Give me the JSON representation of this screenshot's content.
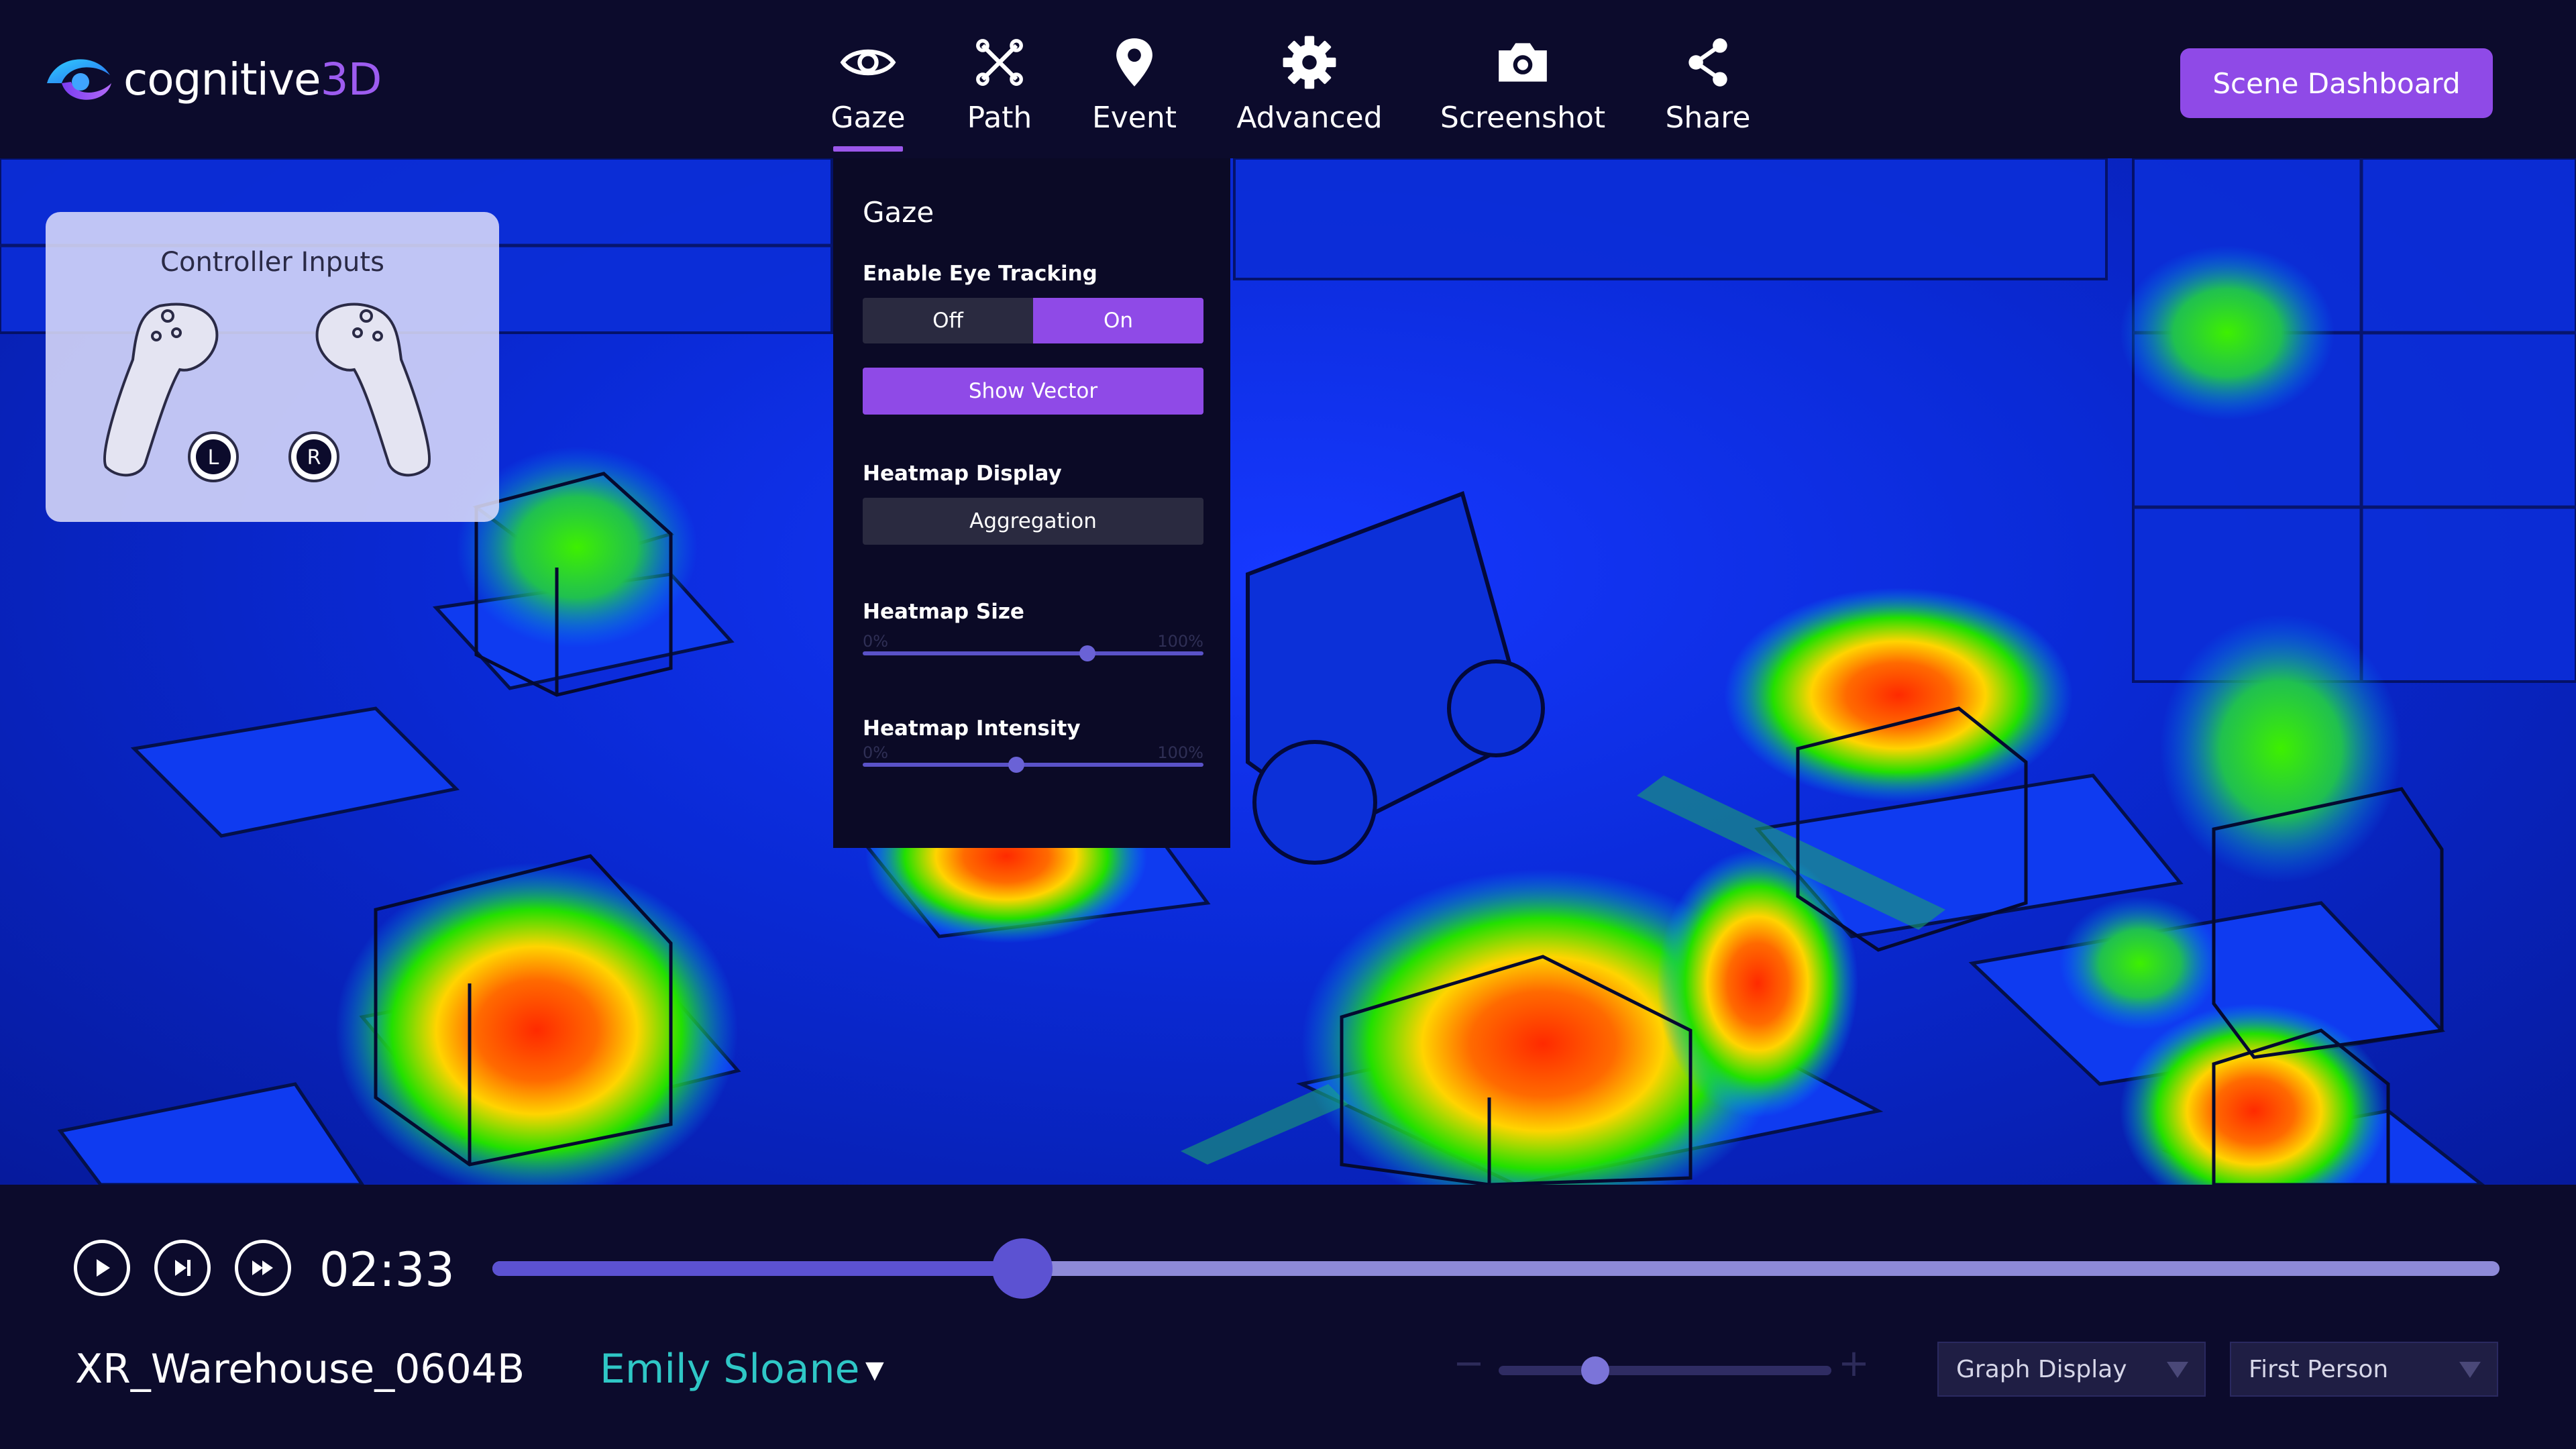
{
  "app": {
    "logo_text_main": "cognitive",
    "logo_text_accent": "3D",
    "colors": {
      "accent": "#8f4ae7",
      "teal": "#2fc7c6",
      "background": "#0c0b2c"
    }
  },
  "toolbar": {
    "items": [
      {
        "label": "Gaze",
        "icon": "eye-icon",
        "active": true
      },
      {
        "label": "Path",
        "icon": "path-cross-icon",
        "active": false
      },
      {
        "label": "Event",
        "icon": "map-pin-icon",
        "active": false
      },
      {
        "label": "Advanced",
        "icon": "gear-icon",
        "active": false
      },
      {
        "label": "Screenshot",
        "icon": "camera-icon",
        "active": false
      },
      {
        "label": "Share",
        "icon": "share-icon",
        "active": false
      }
    ],
    "scene_dashboard_label": "Scene Dashboard"
  },
  "controller_card": {
    "title": "Controller Inputs",
    "left_label": "L",
    "right_label": "R"
  },
  "gaze_panel": {
    "title": "Gaze",
    "eye_tracking": {
      "label": "Enable Eye Tracking",
      "off_label": "Off",
      "on_label": "On",
      "value": "On"
    },
    "show_vector_label": "Show Vector",
    "heatmap_display": {
      "label": "Heatmap Display",
      "value": "Aggregation"
    },
    "heatmap_size": {
      "label": "Heatmap Size",
      "min_label": "0%",
      "max_label": "100%",
      "value_pct": 66
    },
    "heatmap_intensity": {
      "label": "Heatmap Intensity",
      "min_label": "0%",
      "max_label": "100%",
      "value_pct": 45
    }
  },
  "playback": {
    "time": "02:33",
    "progress_pct": 26.4,
    "controls": [
      "play-icon",
      "skip-next-icon",
      "fast-forward-icon"
    ]
  },
  "footer": {
    "scene_name": "XR_Warehouse_0604B",
    "user_name": "Emily Sloane",
    "user_caret": "▼",
    "zoom": {
      "minus": "−",
      "plus": "+",
      "value_pct": 29
    },
    "graph_display": "Graph Display",
    "camera_mode": "First Person"
  }
}
